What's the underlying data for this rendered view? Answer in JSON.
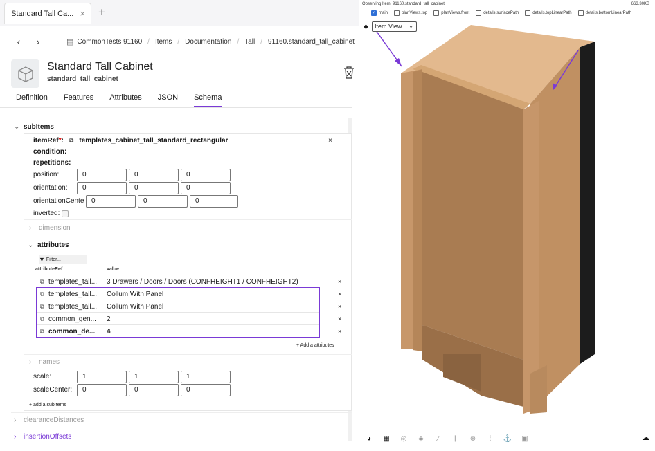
{
  "tab": {
    "title": "Standard Tall Ca...",
    "close": "×",
    "new": "+"
  },
  "nav": {
    "back": "‹",
    "forward": "›"
  },
  "breadcrumb": [
    "CommonTests 91160",
    "Items",
    "Documentation",
    "Tall",
    "91160.standard_tall_cabinet"
  ],
  "item": {
    "title": "Standard Tall Cabinet",
    "subtitle": "standard_tall_cabinet"
  },
  "tabs": [
    "Definition",
    "Features",
    "Attributes",
    "JSON",
    "Schema"
  ],
  "active_tab": "Schema",
  "subitems": {
    "label": "subItems",
    "itemref_label": "itemRef",
    "required_mark": "*",
    "itemref_value": "templates_cabinet_tall_standard_rectangular",
    "condition": "condition:",
    "repetitions": "repetitions:",
    "position_label": "position:",
    "position": [
      "0",
      "0",
      "0"
    ],
    "orientation_label": "orientation:",
    "orientation": [
      "0",
      "0",
      "0"
    ],
    "orientation_center_label": "orientationCente",
    "orientation_center": [
      "0",
      "0",
      "0"
    ],
    "inverted_label": "inverted:",
    "dimension": "dimension",
    "attributes_label": "attributes",
    "filter_placeholder": "Filter...",
    "col_ref": "attributeRef",
    "col_value": "value",
    "rows": [
      {
        "ref": "templates_tall...",
        "value": "3 Drawers / Doors / Doors (CONFHEIGHT1 / CONFHEIGHT2)",
        "bold": false
      },
      {
        "ref": "templates_tall...",
        "value": "Collum With Panel",
        "bold": false
      },
      {
        "ref": "templates_tall...",
        "value": "Collum With Panel",
        "bold": false
      },
      {
        "ref": "common_gen...",
        "value": "2",
        "bold": false
      },
      {
        "ref": "common_de...",
        "value": "4",
        "bold": true
      }
    ],
    "add_attribute": "+ Add a attributes",
    "names": "names",
    "scale_label": "scale:",
    "scale": [
      "1",
      "1",
      "1"
    ],
    "scale_center_label": "scaleCenter:",
    "scale_center": [
      "0",
      "0",
      "0"
    ],
    "add_subitem": "+ add a subItems"
  },
  "clearance": "clearanceDistances",
  "insertion": "insertionOffsets",
  "viewer": {
    "observing": "Observing Item: 91160.standard_tall_cabinet",
    "size": "663.30KB",
    "checkboxes": [
      {
        "label": "main",
        "checked": true
      },
      {
        "label": "planViews.top",
        "checked": false
      },
      {
        "label": "planViews.front",
        "checked": false
      },
      {
        "label": "details.surfacePath",
        "checked": false
      },
      {
        "label": "details.topLinearPath",
        "checked": false
      },
      {
        "label": "details.bottomLinearPath",
        "checked": false
      }
    ],
    "view_select": "Item View",
    "accent": "#7a3ad6",
    "wood_front": "#b98a5c",
    "wood_side": "#c79a6b",
    "wood_top": "#e2b88d"
  }
}
